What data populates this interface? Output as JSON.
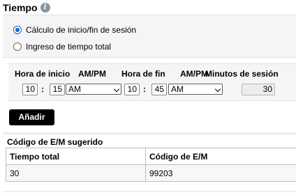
{
  "section": {
    "title": "Tiempo",
    "info_icon": "info-icon"
  },
  "mode": {
    "options": [
      {
        "label": "Cálculo de inicio/fin de sesión",
        "selected": true
      },
      {
        "label": "Ingreso de tiempo total",
        "selected": false
      }
    ]
  },
  "time": {
    "headers": {
      "start": "Hora de inicio",
      "ampm1": "AM/PM",
      "end": "Hora de fin",
      "ampm2": "AM/PM",
      "minutes": "Minutos de sesión"
    },
    "start_hour": "10",
    "start_minute": "15",
    "start_ampm": "AM",
    "end_hour": "10",
    "end_minute": "45",
    "end_ampm": "AM",
    "session_minutes": "30",
    "separator": ":"
  },
  "add_button": {
    "label": "Añadir"
  },
  "suggested": {
    "title": "Código de E/M sugerido",
    "columns": [
      "Tiempo total",
      "Código de E/M"
    ],
    "rows": [
      [
        "30",
        "99203"
      ]
    ]
  }
}
